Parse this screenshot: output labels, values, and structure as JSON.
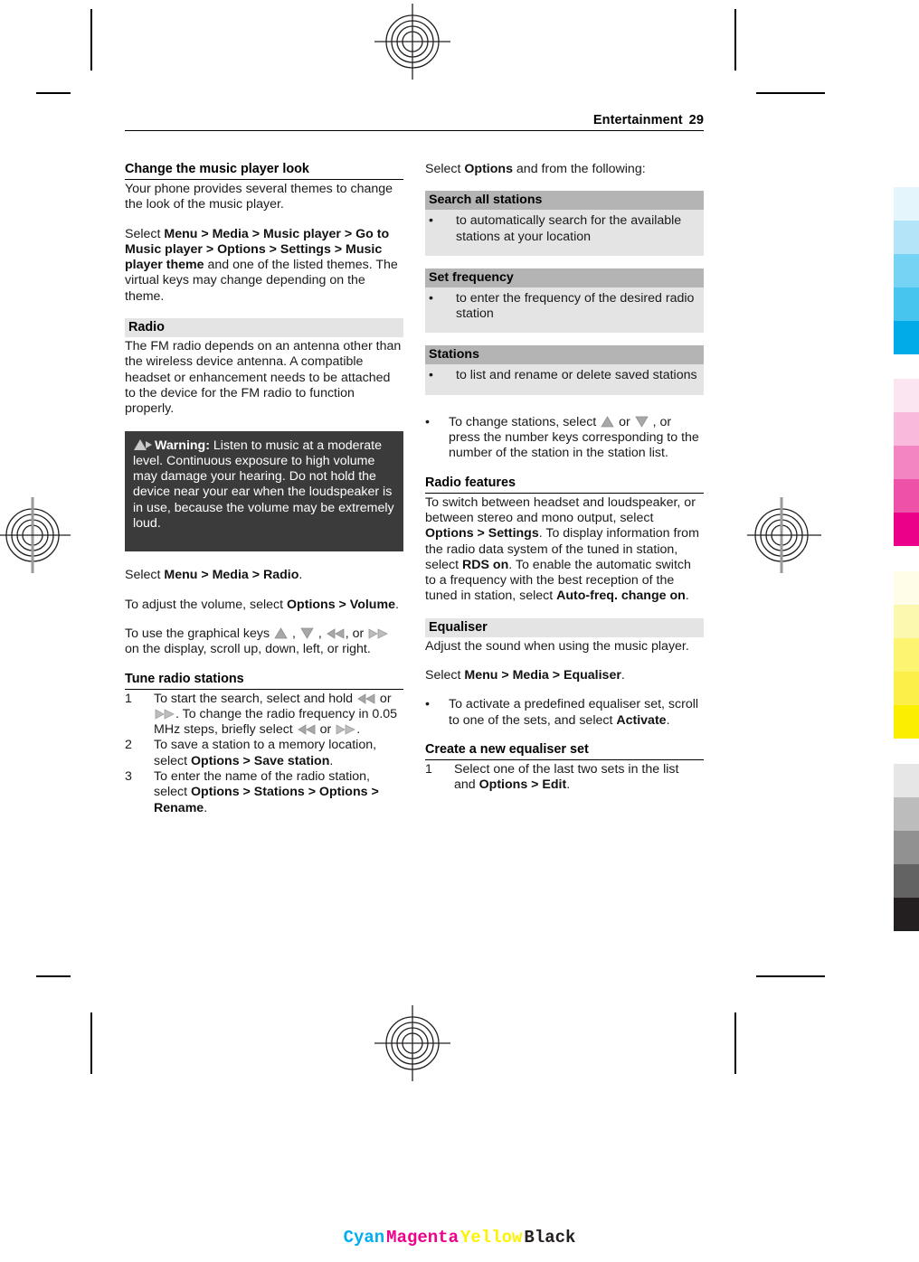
{
  "running_head": {
    "section": "Entertainment",
    "page_number": "29"
  },
  "left_column": {
    "heading_music_look": "Change the music player look",
    "para_themes": "Your phone provides several themes to change the look of the music player.",
    "para_select_path": {
      "prefix": "Select ",
      "bold1": "Menu",
      "sep1": " > ",
      "bold2": "Media",
      "sep2": " > ",
      "bold3": "Music player",
      "sep3": " > ",
      "bold4": "Go to Music player",
      "sep4": " > ",
      "bold5": "Options",
      "sep5": " > ",
      "bold6": "Settings",
      "sep6": " > ",
      "bold7": "Music player theme",
      "suffix": " and one of the listed themes. The virtual keys may change depending on the theme."
    },
    "heading_radio": "Radio",
    "para_fm_antenna": "The FM radio depends on an antenna other than the wireless device antenna. A compatible headset or enhancement needs to be attached to the device for the FM radio to function properly.",
    "warning": {
      "label": "Warning:",
      "text": " Listen to music at a moderate level. Continuous exposure to high volume may damage your hearing. Do not hold the device near your ear when the loudspeaker is in use, because the volume may be extremely loud."
    },
    "para_select_radio": {
      "prefix": "Select ",
      "bold1": "Menu",
      "sep1": " > ",
      "bold2": "Media",
      "sep2": " > ",
      "bold3": "Radio",
      "suffix": "."
    },
    "para_volume": {
      "prefix": "To adjust the volume, select ",
      "bold1": "Options",
      "sep1": " > ",
      "bold2": "Volume",
      "suffix": "."
    },
    "para_graphical_keys": {
      "prefix": "To use the graphical keys ",
      "mid1": " , ",
      "mid2": " , ",
      "mid3": ", or ",
      "suffix": " on the display, scroll up, down, left, or right."
    },
    "heading_tune": "Tune radio stations",
    "tune_steps": [
      {
        "num": "1",
        "part1": "To start the search, select and hold ",
        "part2": " or ",
        "part3": ". To change the radio frequency in 0.05 MHz steps, briefly select ",
        "part4": " or ",
        "part5": "."
      },
      {
        "num": "2",
        "prefix": "To save a station to a memory location, select ",
        "bold1": "Options",
        "sep1": " > ",
        "bold2": "Save station",
        "suffix": "."
      },
      {
        "num": "3",
        "prefix": "To enter the name of the radio station, select ",
        "bold1": "Options",
        "sep1": " > ",
        "bold2": "Stations",
        "sep2": " > ",
        "bold3": "Options",
        "sep3": " > ",
        "bold4": "Rename",
        "suffix": "."
      }
    ]
  },
  "right_column": {
    "para_select_options": {
      "prefix": "Select ",
      "bold1": "Options",
      "suffix": " and from the following:"
    },
    "options_table": [
      {
        "header": "Search all stations",
        "bullet": "•",
        "text": "to automatically search for the available stations at your location"
      },
      {
        "header": "Set frequency",
        "bullet": "•",
        "text": "to enter the frequency of the desired radio station"
      },
      {
        "header": "Stations",
        "bullet": "•",
        "text": "to list and rename or delete saved stations"
      }
    ],
    "change_stations_bullet": {
      "bullet": "•",
      "part1": "To change stations, select ",
      "part2": " or ",
      "part3": " , or press the number keys corresponding to the number of the station in the station list."
    },
    "heading_radio_features": "Radio features",
    "para_radio_features": {
      "prefix": "To switch between headset and loudspeaker, or between stereo and mono output, select ",
      "bold1": "Options",
      "sep1": " > ",
      "bold2": "Settings",
      "mid1": ". To display information from the radio data system of the tuned in station, select ",
      "bold3": "RDS on",
      "mid2": ". To enable the automatic switch to a frequency with the best reception of the tuned in station, select ",
      "bold4": "Auto-freq. change on",
      "suffix": "."
    },
    "heading_equaliser": "Equaliser",
    "para_equaliser": "Adjust the sound when using the music player.",
    "para_select_equaliser": {
      "prefix": "Select ",
      "bold1": "Menu",
      "sep1": " > ",
      "bold2": "Media",
      "sep2": " > ",
      "bold3": "Equaliser",
      "suffix": "."
    },
    "activate_bullet": {
      "bullet": "•",
      "prefix": "To activate a predefined equaliser set, scroll to one of the sets, and select ",
      "bold1": "Activate",
      "suffix": "."
    },
    "heading_create_eq": "Create a new equaliser set",
    "create_steps": [
      {
        "num": "1",
        "prefix": "Select one of the last two sets in the list and ",
        "bold1": "Options",
        "sep1": " > ",
        "bold2": "Edit",
        "suffix": "."
      }
    ]
  },
  "color_bars": {
    "cyan": [
      "#e4f5fc",
      "#b4e4f7",
      "#75d3f4",
      "#47c5ef",
      "#00abe7"
    ],
    "magenta": [
      "#fbe5f1",
      "#f8b9dd",
      "#f285c2",
      "#ee52a8",
      "#ea0089"
    ],
    "yellow": [
      "#fffce8",
      "#fdf8b0",
      "#fdf472",
      "#fcef4a",
      "#fbee00"
    ],
    "black": [
      "#e6e6e6",
      "#bcbcbc",
      "#919191",
      "#636363",
      "#231f20"
    ]
  },
  "cmyk_caption": [
    {
      "label": "Cyan",
      "color": "#00aeef"
    },
    {
      "label": "Magenta",
      "color": "#ec008c"
    },
    {
      "label": "Yellow",
      "color": "#fff200"
    },
    {
      "label": "Black",
      "color": "#231f20"
    }
  ]
}
